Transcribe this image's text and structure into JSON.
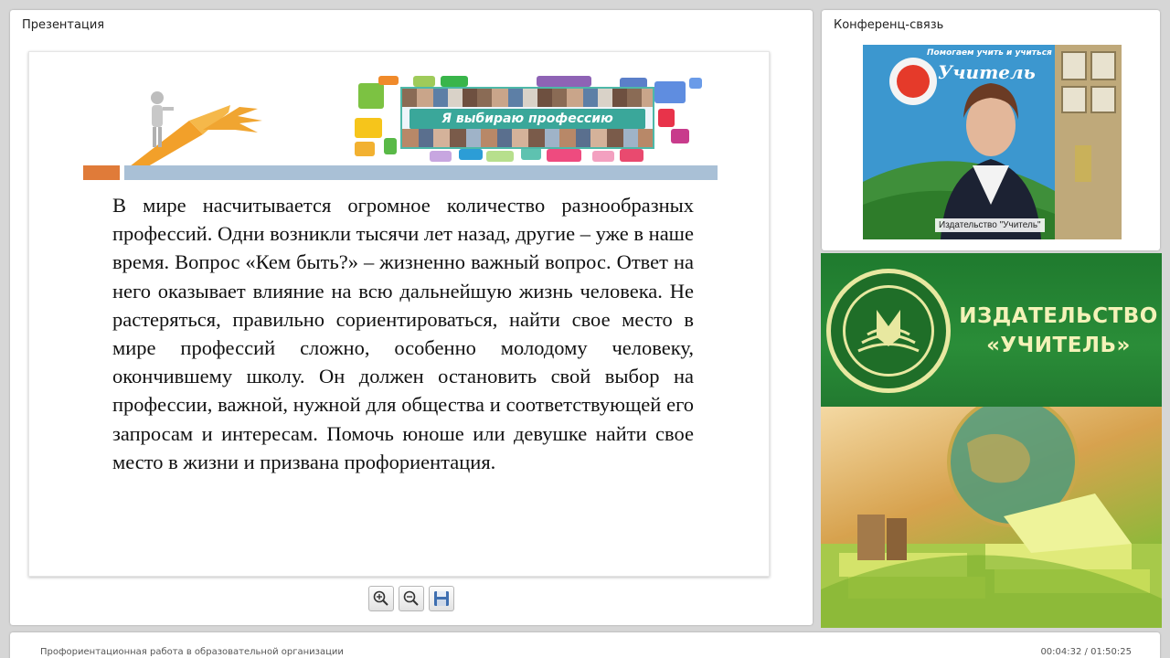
{
  "presentation": {
    "title": "Презентация",
    "slide": {
      "banner_text": "Я выбираю профессию",
      "body_text": "В мире насчитывается огромное количество разнообразных профессий. Одни возникли тысячи лет назад, другие – уже в наше время. Вопрос «Кем быть?» – жизненно важный вопрос. Ответ на него оказывает влияние на всю дальнейшую жизнь человека. Не растеряться, правильно сориентироваться, найти свое место в мире профессий сложно, особенно молодому человеку, окончившему школу. Он должен остановить свой выбор на профессии, важной, нужной для общества и соответствующей его запросам и интересам. Помочь юноше или девушке найти свое место в жизни и призвана профориентация."
    },
    "toolbar": {
      "zoom_in_icon": "zoom-in-icon",
      "zoom_out_icon": "zoom-out-icon",
      "save_icon": "save-icon"
    }
  },
  "conference": {
    "title": "Конференц-связь",
    "video_caption": "Издательство \"Учитель\"",
    "poster_top": "Помогаем учить и учиться",
    "poster_brand": "Учитель"
  },
  "advert": {
    "line1": "ИЗДАТЕЛЬСТВО",
    "line2": "«УЧИТЕЛЬ»"
  },
  "status": {
    "webinar_title": "Профориентационная работа в образовательной организации",
    "time": "00:04:32 / 01:50:25"
  },
  "colors": {
    "accent_green": "#2a8d38",
    "header_bar": "#a9c0d6",
    "banner_teal": "#3aa79a"
  }
}
